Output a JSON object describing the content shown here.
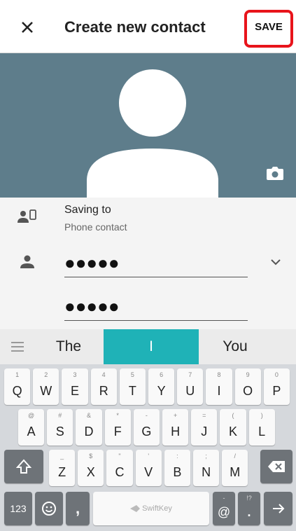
{
  "header": {
    "title": "Create new contact",
    "save_label": "SAVE",
    "highlight_color": "#e8141b"
  },
  "photo": {
    "background": "#5e7d8b"
  },
  "form": {
    "saving_to_title": "Saving to",
    "saving_to_sub": "Phone contact",
    "first_field_value": "●●●●●",
    "second_field_value": "●●●●●"
  },
  "suggestions": [
    "The",
    "I",
    "You"
  ],
  "keyboard": {
    "row1": [
      {
        "main": "Q",
        "sub": "1"
      },
      {
        "main": "W",
        "sub": "2"
      },
      {
        "main": "E",
        "sub": "3"
      },
      {
        "main": "R",
        "sub": "4"
      },
      {
        "main": "T",
        "sub": "5"
      },
      {
        "main": "Y",
        "sub": "6"
      },
      {
        "main": "U",
        "sub": "7"
      },
      {
        "main": "I",
        "sub": "8"
      },
      {
        "main": "O",
        "sub": "9"
      },
      {
        "main": "P",
        "sub": "0"
      }
    ],
    "row2": [
      {
        "main": "A",
        "sub": "@"
      },
      {
        "main": "S",
        "sub": "#"
      },
      {
        "main": "D",
        "sub": "&"
      },
      {
        "main": "F",
        "sub": "*"
      },
      {
        "main": "G",
        "sub": "-"
      },
      {
        "main": "H",
        "sub": "+"
      },
      {
        "main": "J",
        "sub": "="
      },
      {
        "main": "K",
        "sub": "("
      },
      {
        "main": "L",
        "sub": ")"
      }
    ],
    "row3": [
      {
        "main": "Z",
        "sub": "_"
      },
      {
        "main": "X",
        "sub": "$"
      },
      {
        "main": "C",
        "sub": "\""
      },
      {
        "main": "V",
        "sub": "'"
      },
      {
        "main": "B",
        "sub": ":"
      },
      {
        "main": "N",
        "sub": ";"
      },
      {
        "main": "M",
        "sub": "/"
      }
    ],
    "num_key": "123",
    "comma_key": ",",
    "space_brand": "SwiftKey",
    "at_key": "@",
    "period_key": ".",
    "period_sub": "!?",
    "at_sub": "-"
  }
}
